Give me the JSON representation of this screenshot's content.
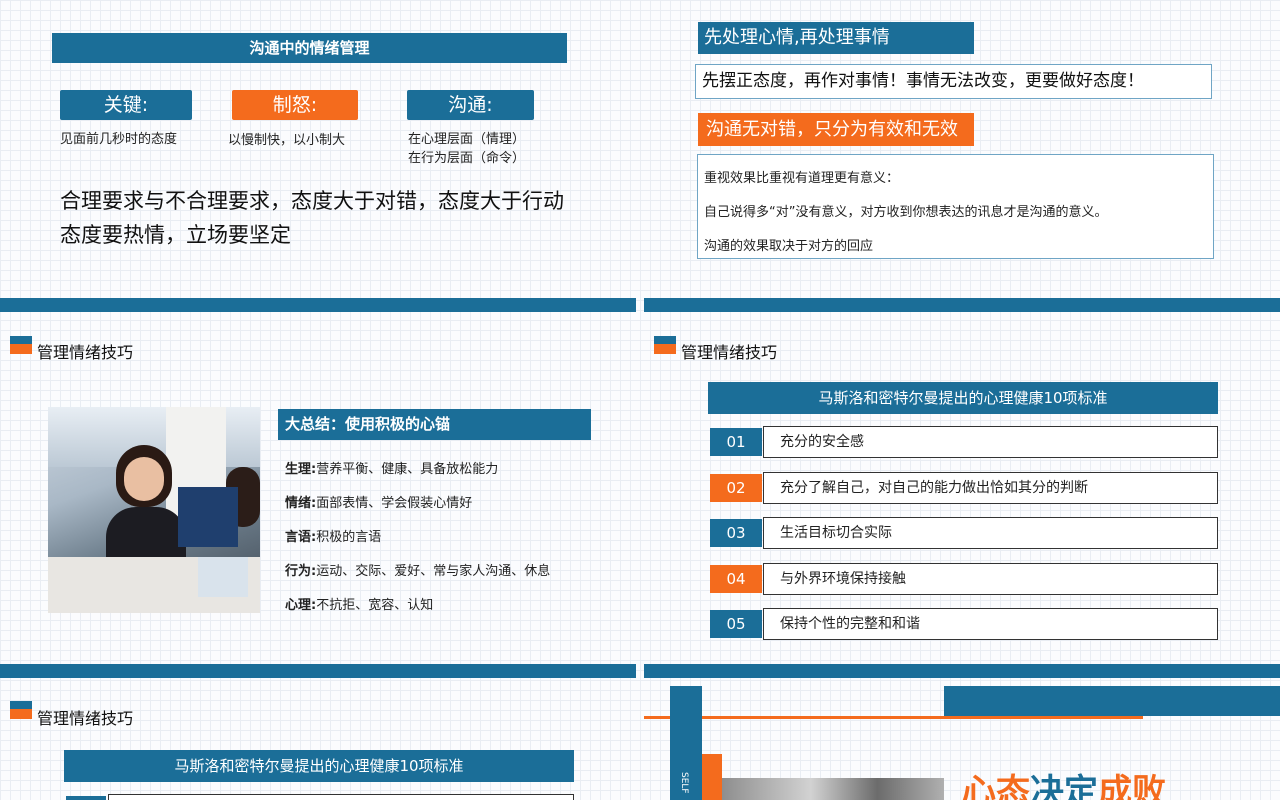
{
  "s1": {
    "title": "沟通中的情绪管理",
    "pills": [
      {
        "label": "关键:",
        "desc1": "见面前几秒时的态度",
        "desc2": ""
      },
      {
        "label": "制怒:",
        "desc1": "以慢制快，以小制大",
        "desc2": ""
      },
      {
        "label": "沟通:",
        "desc1": "在心理层面（情理）",
        "desc2": "在行为层面（命令）"
      }
    ],
    "line1": "合理要求与不合理要求，态度大于对错，态度大于行动",
    "line2": "态度要热情，立场要坚定"
  },
  "s2": {
    "heading1": "先处理心情,再处理事情",
    "box1": "先摆正态度，再作对事情！事情无法改变，更要做好态度！",
    "heading2": "沟通无对错，只分为有效和无效",
    "lines": [
      "重视效果比重视有道理更有意义：",
      "自己说得多“对”没有意义，对方收到你想表达的讯息才是沟通的意义。",
      "沟通的效果取决于对方的回应"
    ]
  },
  "s3": {
    "section": "管理情绪技巧",
    "summary_title": "大总结：使用积极的心锚",
    "items": [
      {
        "k": "生理:",
        "v": "营养平衡、健康、具备放松能力"
      },
      {
        "k": "情绪:",
        "v": "面部表情、学会假装心情好"
      },
      {
        "k": "言语:",
        "v": "积极的言语"
      },
      {
        "k": "行为:",
        "v": "运动、交际、爱好、常与家人沟通、休息"
      },
      {
        "k": "心理:",
        "v": "不抗拒、宽容、认知"
      }
    ]
  },
  "s4": {
    "section": "管理情绪技巧",
    "title": "马斯洛和密特尔曼提出的心理健康10项标准",
    "rows": [
      {
        "num": "01",
        "text": "充分的安全感",
        "color": "#1b6e98"
      },
      {
        "num": "02",
        "text": "充分了解自己，对自己的能力做出恰如其分的判断",
        "color": "#f46b1d"
      },
      {
        "num": "03",
        "text": "生活目标切合实际",
        "color": "#1b6e98"
      },
      {
        "num": "04",
        "text": "与外界环境保持接触",
        "color": "#f46b1d"
      },
      {
        "num": "05",
        "text": "保持个性的完整和和谐",
        "color": "#1b6e98"
      }
    ]
  },
  "s5": {
    "section": "管理情绪技巧",
    "title": "马斯洛和密特尔曼提出的心理健康10项标准"
  },
  "s6": {
    "vertical": "SELF",
    "big_title_1": "心态",
    "big_title_2": "决定",
    "big_title_3": "成败"
  }
}
